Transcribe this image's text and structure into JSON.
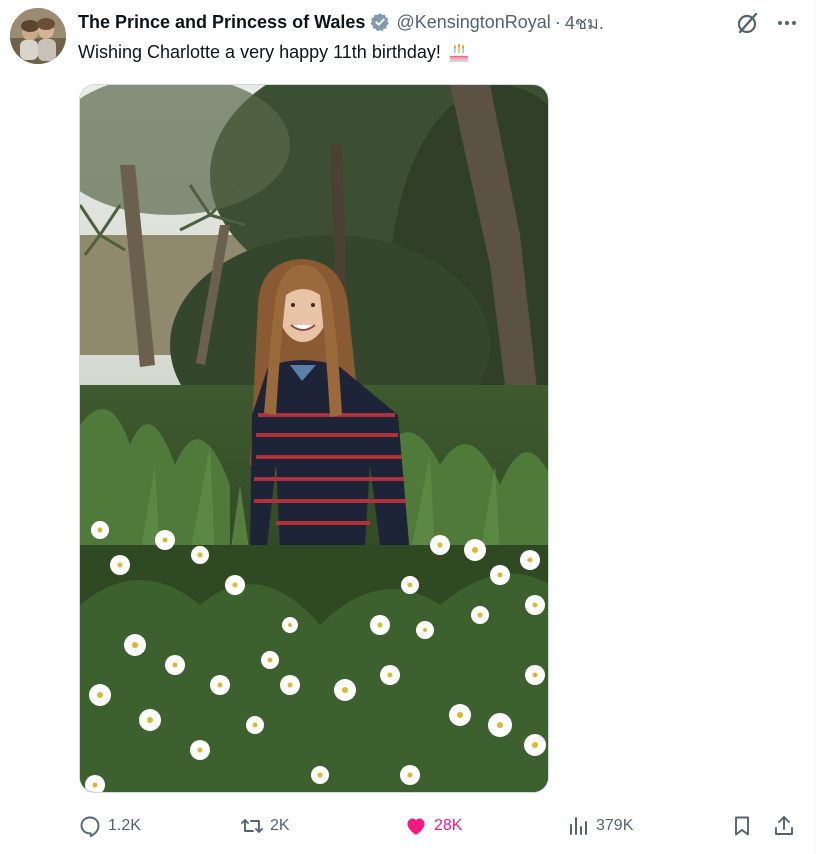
{
  "post": {
    "author_name": "The Prince and Princess of Wales",
    "handle": "@KensingtonRoyal",
    "separator": "·",
    "time": "4ชม.",
    "text": "Wishing Charlotte a very happy 11th birthday!",
    "emoji": "birthday-cake-icon"
  },
  "actions": {
    "replies": "1.2K",
    "reposts": "2K",
    "likes": "28K",
    "views": "379K"
  },
  "colors": {
    "like_active": "#f91880",
    "muted": "#536471",
    "verified_badge": "#829aab"
  }
}
